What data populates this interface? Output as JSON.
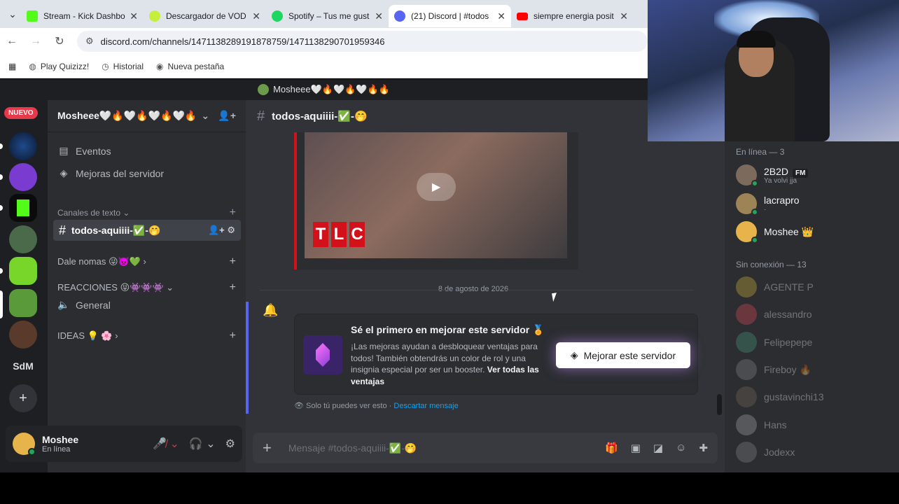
{
  "browser": {
    "tabs": [
      {
        "title": "Stream - Kick Dashbo",
        "color": "#53fc18"
      },
      {
        "title": "Descargador de VOD",
        "color": "#c6ef3c"
      },
      {
        "title": "Spotify – Tus me gust",
        "color": "#1ed760"
      },
      {
        "title": "(21) Discord | #todos",
        "color": "#5865f2"
      },
      {
        "title": "siempre energia posit",
        "color": "#ff0000"
      }
    ],
    "url": "discord.com/channels/1471138289191878759/1471138290701959346",
    "bookmarks": [
      "Play Quizizz!",
      "Historial",
      "Nueva pestaña"
    ]
  },
  "discord": {
    "title": "Mosheee🤍🔥🤍🔥🤍🔥🔥",
    "nuevo": "NUEVO",
    "server_abbr": "SdM",
    "server_name": "Mosheee🤍🔥🤍🔥🤍🔥🤍🔥",
    "events": "Eventos",
    "boosts": "Mejoras del servidor",
    "cat_text": "Canales de texto ⌄",
    "channel": "todos-aquiiii-✅-🤭",
    "cat_dale": "Dale nomas 😜👿💚 ›",
    "cat_reac": "REACCIONES 😝👾👾👾 ⌄",
    "general": "General",
    "cat_ideas": "IDEAS 💡 🌸 ›",
    "user": {
      "name": "Moshee",
      "status": "En línea"
    },
    "date": "8 de agosto de 2026",
    "boost": {
      "title": "Sé el primero en mejorar este servidor 🏅",
      "text": "¡Las mejoras ayudan a desbloquear ventajas para todos! También obtendrás un color de rol y una insignia especial por ser un booster.",
      "link": "Ver todas las ventajas",
      "button": "Mejorar este servidor"
    },
    "ephemeral": "Solo tú puedes ver esto · ",
    "dismiss": "Descartar mensaje",
    "composer_placeholder": "Mensaje #todos-aquiiii-✅-🤭"
  },
  "members": {
    "online_header": "En línea — 3",
    "offline_header": "Sin conexión — 13",
    "online": [
      {
        "name": "2B2D",
        "sub": "Ya volvi jja",
        "badge": "FM",
        "color": "#7c6b5d"
      },
      {
        "name": "lacrapro",
        "sub": "·",
        "color": "#9c8457"
      },
      {
        "name": "Moshee 👑",
        "sub": "",
        "color": "#e6b44a"
      }
    ],
    "offline": [
      {
        "name": "AGENTE P",
        "color": "#d4b43a"
      },
      {
        "name": "alessandro",
        "color": "#e24a5a"
      },
      {
        "name": "Felipepepe",
        "color": "#4a9b7a"
      },
      {
        "name": "Fireboy 🔥",
        "color": "#888"
      },
      {
        "name": "gustavinchi13",
        "color": "#7a6a5a"
      },
      {
        "name": "Hans",
        "color": "#aaa"
      },
      {
        "name": "Jodexx",
        "color": "#888"
      }
    ]
  }
}
